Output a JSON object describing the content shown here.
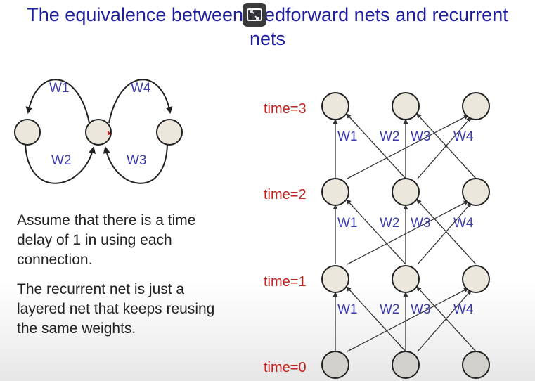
{
  "slide": {
    "title_line1": "The equivalence between feedforward nets and recurrent",
    "title_line2": "nets",
    "paragraph1": "Assume that there is a time delay of 1 in using each connection.",
    "paragraph2": "The recurrent net is just a layered net that keeps reusing the same weights."
  },
  "recurrent_net": {
    "weights": [
      "W1",
      "W2",
      "W3",
      "W4"
    ]
  },
  "unrolled_net": {
    "time_labels": [
      "time=3",
      "time=2",
      "time=1",
      "time=0"
    ],
    "weight_labels": [
      "W1",
      "W2",
      "W3",
      "W4"
    ]
  },
  "colors": {
    "title": "#1f1f9e",
    "weight_label": "#3b3bab",
    "time_label": "#c0221f",
    "node_fill": "#ebe7dc",
    "input_node_fill": "#d3d1cb"
  },
  "overlay": {
    "icon": "expand-icon"
  }
}
